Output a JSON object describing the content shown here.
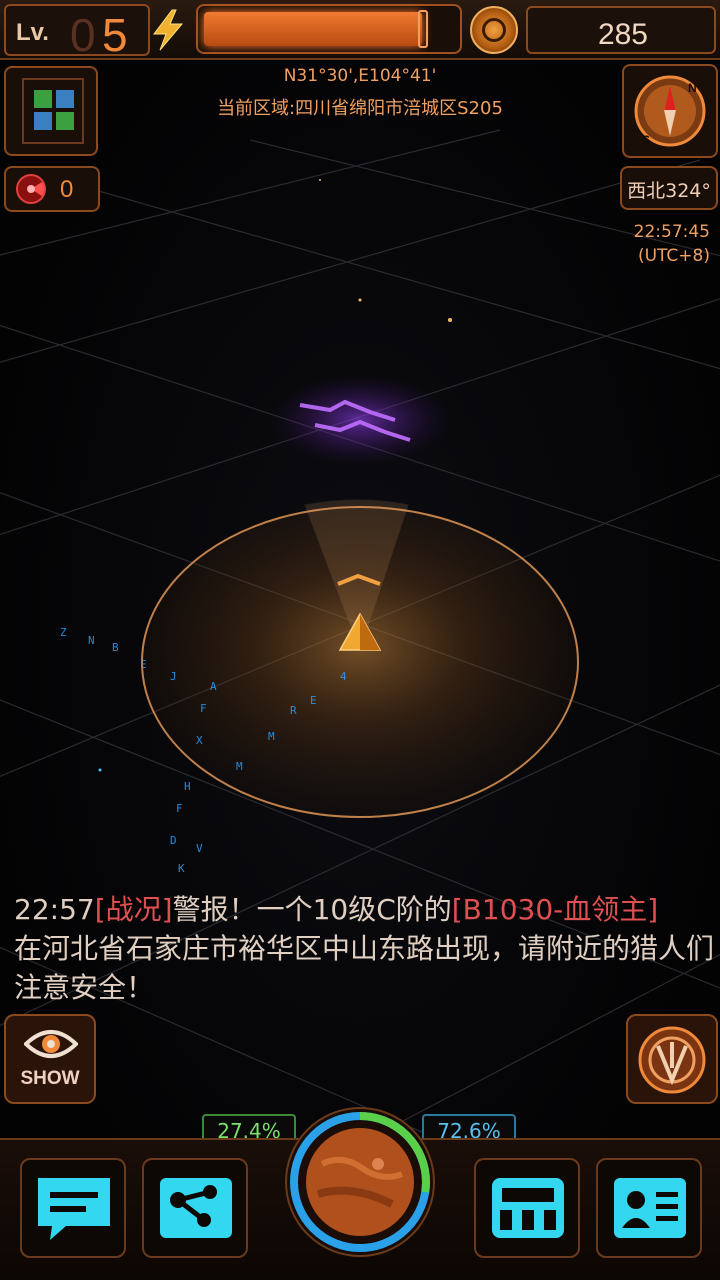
{
  "header": {
    "level_label": "Lv.",
    "level_ghost": "0",
    "level_value": "5",
    "energy_fraction": 0.87,
    "coin_count": "285"
  },
  "location": {
    "coordinates": "N31°30',E104°41'",
    "region": "当前区域:四川省绵阳市涪城区S205"
  },
  "left_panel": {
    "alert_count": "0"
  },
  "right_panel": {
    "heading": "西北324°",
    "time": "22:57:45",
    "timezone": "(UTC+8)"
  },
  "message": {
    "time": "22:57",
    "tag": "[战况]",
    "text_1": "警报！一个10级C阶的",
    "boss": "[B1030-血领主]",
    "text_2": "在河北省石家庄市裕华区中山东路出现，请附近的猎人们注意安全！"
  },
  "buttons": {
    "show_label": "SHOW"
  },
  "dock": {
    "left_percent": "27.4%",
    "right_percent": "72.6%",
    "left_fraction": 0.274,
    "right_fraction": 0.726
  },
  "colors": {
    "accent": "#f08a3a",
    "alert_red": "#e05050",
    "cyan_icon": "#33d8f0",
    "green_stat": "#7ae06a",
    "blue_stat": "#5ac0f0"
  },
  "icons": [
    "lightning-icon",
    "coin-icon",
    "map-grid-icon",
    "radar-alert-icon",
    "compass-icon",
    "eye-icon",
    "power-icon",
    "chat-icon",
    "share-icon",
    "shop-icon",
    "profile-card-icon",
    "planet-icon",
    "player-arrow-icon"
  ]
}
